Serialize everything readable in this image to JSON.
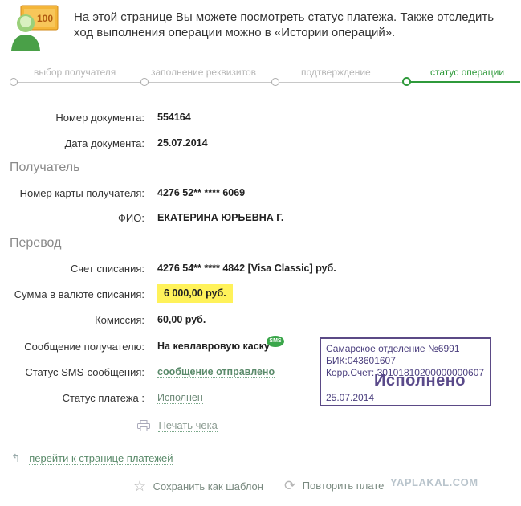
{
  "intro": "На этой странице Вы можете посмотреть статус платежа. Также отследить ход выполнения операции можно в «Истории операций».",
  "steps": [
    {
      "label": "выбор получателя",
      "active": false
    },
    {
      "label": "заполнение реквизитов",
      "active": false
    },
    {
      "label": "подтверждение",
      "active": false
    },
    {
      "label": "статус операции",
      "active": true
    }
  ],
  "document": {
    "number_label": "Номер документа:",
    "number": "554164",
    "date_label": "Дата документа:",
    "date": "25.07.2014"
  },
  "recipient": {
    "section": "Получатель",
    "card_label": "Номер карты получателя:",
    "card": "4276 52** **** 6069",
    "name_label": "ФИО:",
    "name": "ЕКАТЕРИНА ЮРЬЕВНА Г."
  },
  "transfer": {
    "section": "Перевод",
    "account_label": "Счет списания:",
    "account": "4276 54** **** 4842  [Visa Classic]  руб.",
    "amount_label": "Сумма в валюте списания:",
    "amount": "6 000,00  руб.",
    "fee_label": "Комиссия:",
    "fee": "60,00 руб.",
    "message_label": "Сообщение получателю:",
    "message": "На кевлавровую каску",
    "sms_badge": "SMS",
    "sms_status_label": "Статус SMS-сообщения:",
    "sms_status": "сообщение отправлено",
    "payment_status_label": "Статус платежа :",
    "payment_status": "Исполнен"
  },
  "stamp": {
    "line1": "Самарское отделение №6991",
    "line2": "БИК:043601607",
    "line3": "Корр.Счет: 30101810200000000607",
    "big": "Исполнено",
    "date": "25.07.2014"
  },
  "actions": {
    "print": "Печать чека",
    "back": "перейти к странице платежей",
    "save_template": "Сохранить как шаблон",
    "repeat": "Повторить плате"
  },
  "watermark": "YAPLAKAL.COM",
  "colors": {
    "accent": "#2f9a3b",
    "highlight": "#fff25a",
    "stamp": "#5b4a86"
  }
}
